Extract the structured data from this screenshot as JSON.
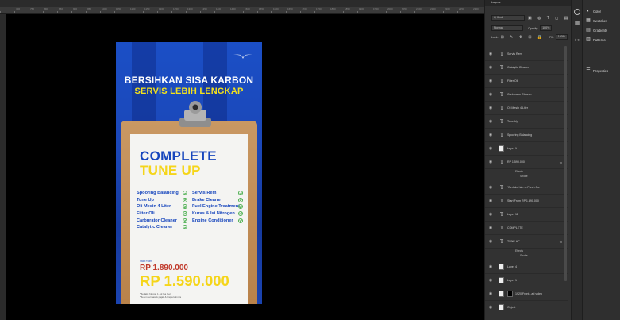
{
  "ruler": {
    "numbers": [
      "",
      "700",
      "750",
      "800",
      "850",
      "900",
      "950",
      "1000",
      "1050",
      "1100",
      "1150",
      "1200",
      "1250",
      "1300",
      "1350",
      "1400",
      "1450",
      "1500",
      "1550",
      "1600",
      "1650",
      "1700",
      "1750",
      "1800",
      "1850",
      "1900",
      "1950",
      "2000",
      "2050",
      "2100",
      "2150",
      "2200",
      "2250",
      "2300"
    ]
  },
  "poster": {
    "headline": "BERSIHKAN SISA KARBON",
    "subline": "SERVIS LEBIH LENGKAP",
    "title_line1": "COMPLETE",
    "title_line2": "TUNE UP",
    "services_left": [
      "Spooring Balancing",
      "Tune Up",
      "Oli Mesin 4 Liter",
      "Filter Oli",
      "Carburator Cleaner",
      "Catalytic Cleaner"
    ],
    "services_right": [
      "Servis Rem",
      "Brake Cleaner",
      "Fuel Engine Treatment",
      "Kuras & Isi Nitrogen",
      "Engine Conditioner"
    ],
    "start_from": "Start From",
    "old_price": "RP 1.890.000",
    "new_price": "RP 1.590.000",
    "note1": "*Berlaku hingga 1 Jul Ga Ger",
    "note2": "*Belum termasuk pajak & biaya lainnya"
  },
  "layers_panel": {
    "tab": "Layers",
    "filter_kind": "Q Kind",
    "blend_mode": "Normal",
    "opacity_label": "Opacity:",
    "opacity_value": "100%",
    "lock_label": "Lock:",
    "fill_label": "Fill:",
    "fill_value": "100%",
    "layers": [
      {
        "type": "text",
        "name": "Servis Rem"
      },
      {
        "type": "text",
        "name": "Catalytic Cleaner"
      },
      {
        "type": "text",
        "name": "Filter Oli"
      },
      {
        "type": "text",
        "name": "Carburator Cleaner"
      },
      {
        "type": "text",
        "name": "Oli Mesin 4 Liter"
      },
      {
        "type": "text",
        "name": "Tune Up"
      },
      {
        "type": "text",
        "name": "Spooring Balancing"
      },
      {
        "type": "image",
        "name": "Layer 1"
      },
      {
        "type": "text",
        "name": "RP 1.590.000",
        "fx": "fx"
      },
      {
        "type": "text",
        "name": "*Berlaku hin...a Fresh Ga"
      },
      {
        "type": "text",
        "name": "Start From RP 1.890.000"
      },
      {
        "type": "text",
        "name": "Layer 11"
      },
      {
        "type": "text",
        "name": "COMPLETE"
      },
      {
        "type": "text",
        "name": "TUNE UP",
        "fx": "fx"
      },
      {
        "type": "image",
        "name": "Layer 4"
      },
      {
        "type": "image",
        "name": "Layer 1"
      },
      {
        "type": "image",
        "name": "1920 Front...ad video"
      },
      {
        "type": "image",
        "name": "Object"
      }
    ],
    "effects_label": "Effects",
    "stroke_label": "Stroke"
  },
  "right_panels": {
    "items": [
      {
        "icon": "color-icon",
        "label": "Color"
      },
      {
        "icon": "swatches-icon",
        "label": "Swatches"
      },
      {
        "icon": "gradients-icon",
        "label": "Gradients"
      },
      {
        "icon": "patterns-icon",
        "label": "Patterns"
      },
      {
        "icon": "properties-icon",
        "label": "Properties"
      }
    ]
  }
}
